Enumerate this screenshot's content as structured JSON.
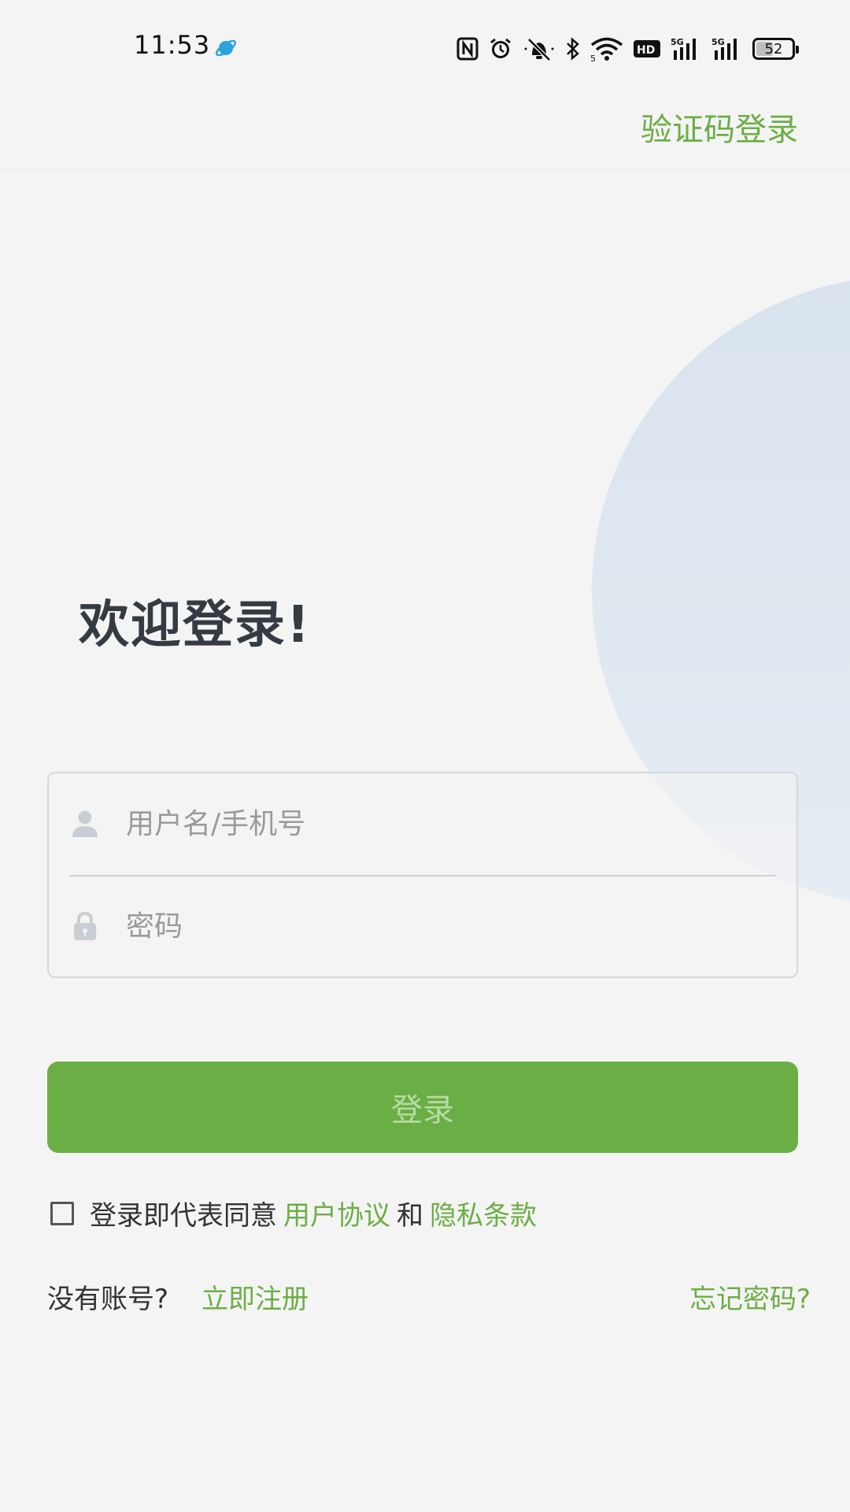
{
  "status_bar": {
    "time": "11:53",
    "battery_level": "52",
    "network_1": "5G",
    "network_2": "5G",
    "hd_label": "HD",
    "wifi_sub": "5"
  },
  "header": {
    "sms_login_label": "验证码登录"
  },
  "welcome": {
    "title": "欢迎登录!"
  },
  "form": {
    "username_placeholder": "用户名/手机号",
    "username_value": "",
    "password_placeholder": "密码",
    "password_value": ""
  },
  "login_button": {
    "label": "登录"
  },
  "agreement": {
    "checked": false,
    "prefix": "登录即代表同意",
    "user_agreement_link": "用户协议",
    "and_text": "和",
    "privacy_link": "隐私条款"
  },
  "footer": {
    "no_account_text": "没有账号?",
    "register_link": "立即注册",
    "forgot_password_link": "忘记密码?"
  },
  "colors": {
    "accent": "#6aae45",
    "accent_text": "#6cae45",
    "title": "#353b42",
    "background": "#f4f4f4"
  }
}
